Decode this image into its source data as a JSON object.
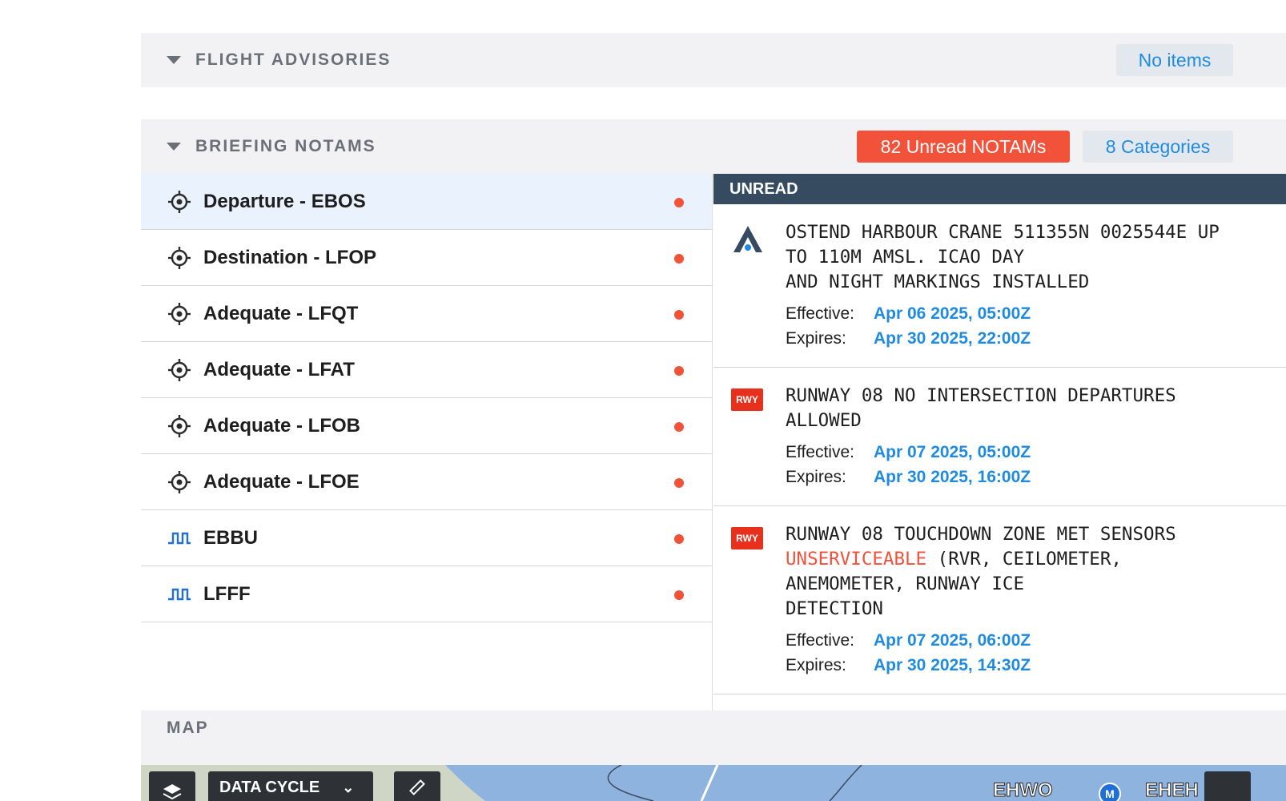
{
  "advisories": {
    "title": "FLIGHT ADVISORIES",
    "status": "No items"
  },
  "notams": {
    "title": "BRIEFING NOTAMS",
    "unread_badge": "82 Unread NOTAMs",
    "categories_badge": "8 Categories",
    "locations": [
      {
        "label": "Departure - EBOS",
        "icon": "airport-target-icon",
        "selected": true,
        "unread": true
      },
      {
        "label": "Destination - LFOP",
        "icon": "airport-target-icon",
        "selected": false,
        "unread": true
      },
      {
        "label": "Adequate - LFQT",
        "icon": "airport-target-icon",
        "selected": false,
        "unread": true
      },
      {
        "label": "Adequate - LFAT",
        "icon": "airport-target-icon",
        "selected": false,
        "unread": true
      },
      {
        "label": "Adequate - LFOB",
        "icon": "airport-target-icon",
        "selected": false,
        "unread": true
      },
      {
        "label": "Adequate - LFOE",
        "icon": "airport-target-icon",
        "selected": false,
        "unread": true
      },
      {
        "label": "EBBU",
        "icon": "fir-boundary-icon",
        "selected": false,
        "unread": true
      },
      {
        "label": "LFFF",
        "icon": "fir-boundary-icon",
        "selected": false,
        "unread": true
      }
    ],
    "panel_header": "UNREAD",
    "items": [
      {
        "icon": "obstacle-icon",
        "text_parts": [
          "OSTEND HARBOUR CRANE 511355N 0025544E UP\nTO 110M AMSL. ICAO DAY\nAND NIGHT MARKINGS INSTALLED"
        ],
        "effective_label": "Effective:",
        "effective": "Apr 06 2025, 05:00Z",
        "expires_label": "Expires:",
        "expires": "Apr 30 2025, 22:00Z"
      },
      {
        "icon": "runway-icon",
        "badge": "RWY",
        "text_parts": [
          "RUNWAY 08 NO INTERSECTION DEPARTURES\nALLOWED"
        ],
        "effective_label": "Effective:",
        "effective": "Apr 07 2025, 05:00Z",
        "expires_label": "Expires:",
        "expires": "Apr 30 2025, 16:00Z"
      },
      {
        "icon": "runway-icon",
        "badge": "RWY",
        "text_before": "RUNWAY 08 TOUCHDOWN ZONE MET SENSORS\n",
        "text_warn": "UNSERVICEABLE",
        "text_after": " (RVR, CEILOMETER,\nANEMOMETER, RUNWAY ICE\nDETECTION",
        "effective_label": "Effective:",
        "effective": "Apr 07 2025, 06:00Z",
        "expires_label": "Expires:",
        "expires": "Apr 30 2025, 14:30Z"
      }
    ]
  },
  "map": {
    "title": "MAP",
    "data_cycle_label": "DATA CYCLE",
    "labels": [
      "EHWO",
      "EHEH"
    ],
    "colors": {
      "water": "#8fb3df",
      "land": "#cfd6c6"
    }
  },
  "colors": {
    "accent": "#1f8be0",
    "alert": "#f2513a",
    "header_dark": "#364a60"
  }
}
